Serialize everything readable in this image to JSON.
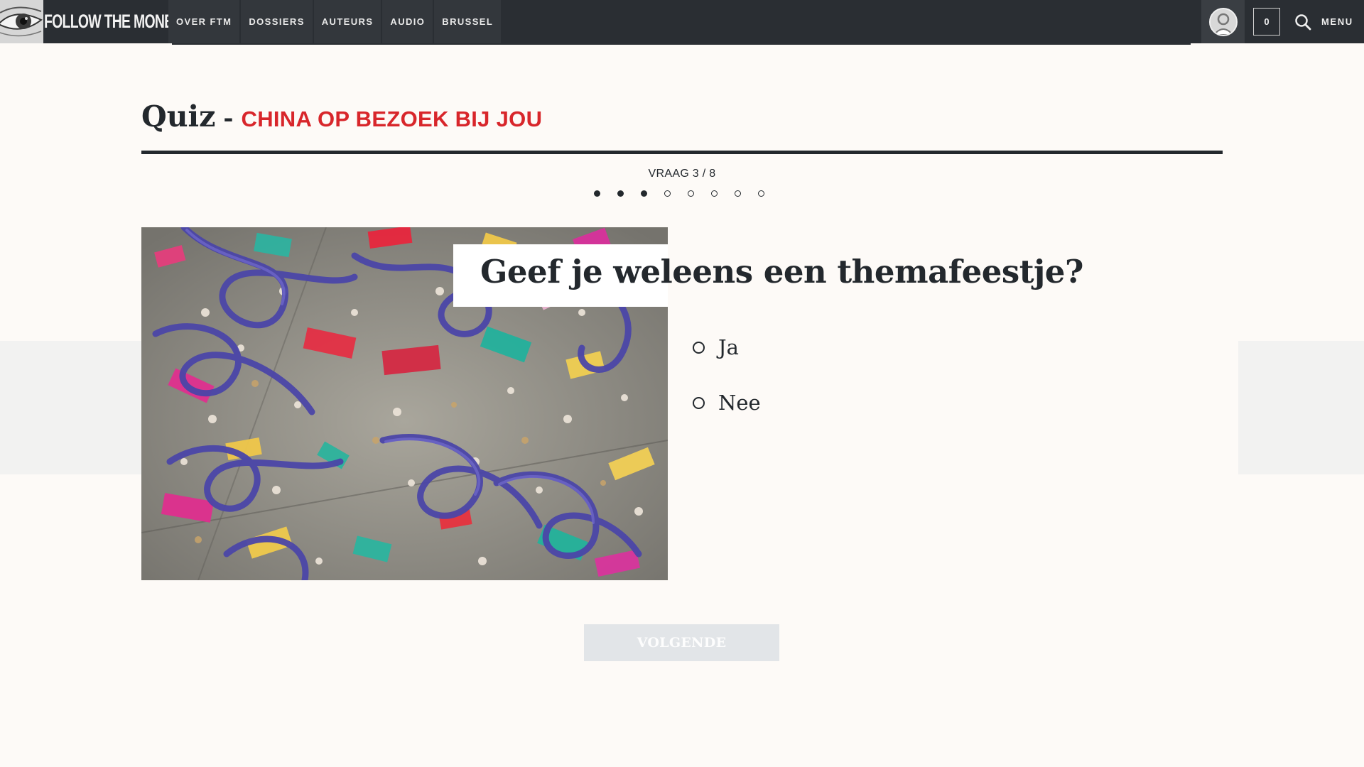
{
  "header": {
    "brand": "FOLLOW THE MONEY",
    "nav": [
      {
        "label": "OVER FTM"
      },
      {
        "label": "DOSSIERS"
      },
      {
        "label": "AUTEURS"
      },
      {
        "label": "AUDIO"
      },
      {
        "label": "BRUSSEL"
      }
    ],
    "counter": "0",
    "menu_label": "MENU",
    "icons": [
      "eye-logo-icon",
      "avatar-icon",
      "search-icon"
    ]
  },
  "quiz": {
    "label": "Quiz",
    "separator": "-",
    "topic": "CHINA OP BEZOEK BIJ JOU",
    "progress_text": "VRAAG 3 / 8",
    "progress": {
      "current": 3,
      "total": 8
    },
    "question": "Geef je weleens een themafeestje?",
    "options": [
      {
        "label": "Ja"
      },
      {
        "label": "Nee"
      }
    ],
    "next_label": "VOLGENDE"
  },
  "colors": {
    "topbar": "#2a2e33",
    "accent_red": "#d8262b",
    "text": "#23282d",
    "background": "#fdfaf7",
    "button_disabled": "#e2e5e8"
  }
}
